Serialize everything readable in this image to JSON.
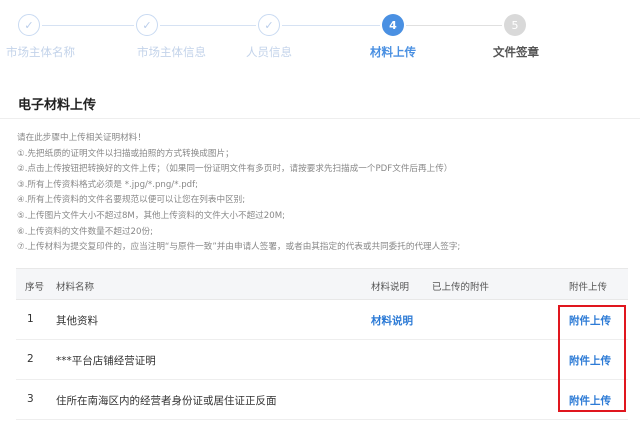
{
  "stepper": {
    "steps": [
      {
        "label": "市场主体名称",
        "state": "done",
        "number": ""
      },
      {
        "label": "市场主体信息",
        "state": "done",
        "number": ""
      },
      {
        "label": "人员信息",
        "state": "done",
        "number": ""
      },
      {
        "label": "材料上传",
        "state": "active",
        "number": "4"
      },
      {
        "label": "文件签章",
        "state": "todo",
        "number": "5"
      }
    ],
    "check_glyph": "✓"
  },
  "section": {
    "title": "电子材料上传"
  },
  "notes": [
    "请在此步骤中上传相关证明材料！",
    "①.先把纸质的证明文件以扫描或拍照的方式转换成图片；",
    "②.点击上传按钮把转换好的文件上传；（如果同一份证明文件有多页时，请按要求先扫描成一个PDF文件后再上传）",
    "③.所有上传资料格式必须是 *.jpg/*.png/*.pdf;",
    "④.所有上传资料的文件名要规范以便可以让您在列表中区别;",
    "⑤.上传图片文件大小不超过8M，其他上传资料的文件大小不超过20M;",
    "⑥.上传资料的文件数量不超过20份;",
    "⑦.上传材料为提交复印件的，应当注明“与原件一致”并由申请人签署，或者由其指定的代表或共同委托的代理人签字;"
  ],
  "table": {
    "headers": {
      "index": "序号",
      "name": "材料名称",
      "desc": "材料说明",
      "uploaded": "已上传的附件",
      "action": "附件上传"
    },
    "rows": [
      {
        "index": "1",
        "name": "其他资料",
        "desc_link": "材料说明",
        "action": "附件上传"
      },
      {
        "index": "2",
        "name": "***平台店铺经营证明",
        "desc_link": "",
        "action": "附件上传"
      },
      {
        "index": "3",
        "name": "住所在南海区内的经营者身份证或居住证正反面",
        "desc_link": "",
        "action": "附件上传"
      }
    ]
  },
  "colors": {
    "accent": "#4a90e2",
    "link": "#2d7bd6",
    "highlight": "#e0161e"
  }
}
